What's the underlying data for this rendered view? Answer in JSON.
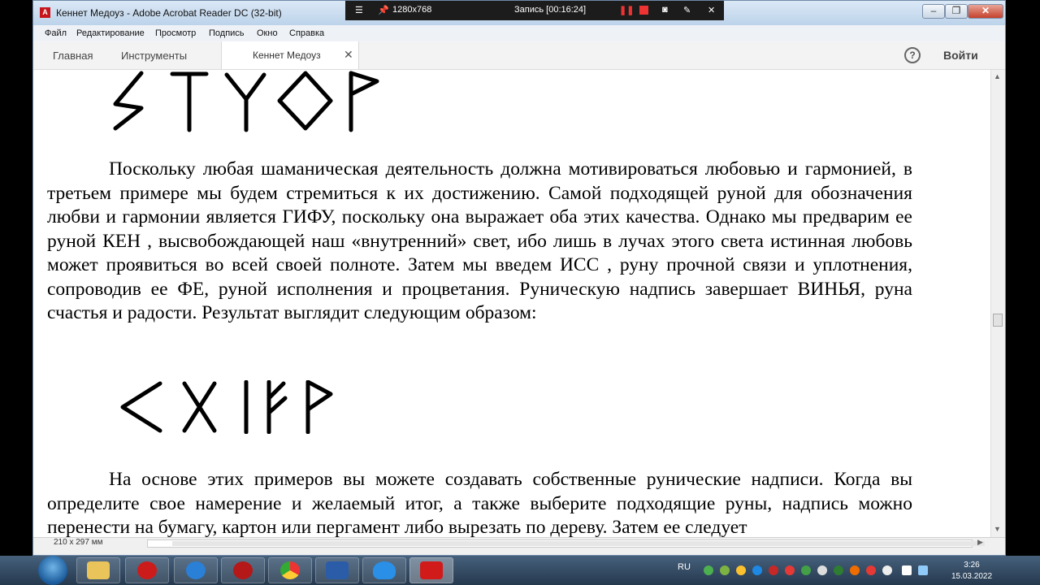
{
  "window": {
    "title": "Кеннет Медоуз - Adobe Acrobat Reader DC (32-bit)",
    "app_icon": "pdf-icon"
  },
  "recorder": {
    "resolution": "1280x768",
    "status": "Запись [00:16:24]"
  },
  "menu": [
    "Файл",
    "Редактирование",
    "Просмотр",
    "Подпись",
    "Окно",
    "Справка"
  ],
  "tabs": {
    "home": "Главная",
    "tools": "Инструменты",
    "document": "Кеннет Медоуз",
    "signin": "Войти"
  },
  "document": {
    "paragraph1": "Поскольку любая шаманическая деятельность должна мотивироваться любовью и гармонией, в третьем примере мы будем стремиться к их достижению. Самой подходящей руной для обозначения любви и гармонии является ГИФУ, поскольку она выражает оба этих качества. Однако мы предварим ее руной КЕН , высвобождающей наш «внутренний» свет, ибо лишь в лучах этого света истинная любовь может проявиться во всей своей полноте. Затем мы введем ИСС , руну прочной связи и уплотнения, сопроводив ее ФЕ, руной исполнения и процветания. Руническую надпись завершает ВИНЬЯ, руна счастья и радости. Результат выглядит следующим образом:",
    "paragraph2": "На основе этих примеров вы можете создавать собственные рунические надписи. Когда вы определите свое намерение и желаемый итог, а также выберите подходящие руны, надпись можно перенести на бумагу, картон или пергамент либо вырезать по дереву. Затем ее следует"
  },
  "status": {
    "page_size": "210 x 297 мм"
  },
  "taskbar": {
    "apps": [
      "explorer",
      "opera",
      "internet-explorer",
      "rune-app",
      "chrome",
      "word",
      "heart-app",
      "acrobat"
    ],
    "lang": "RU",
    "time": "3:26",
    "date": "15.03.2022"
  }
}
